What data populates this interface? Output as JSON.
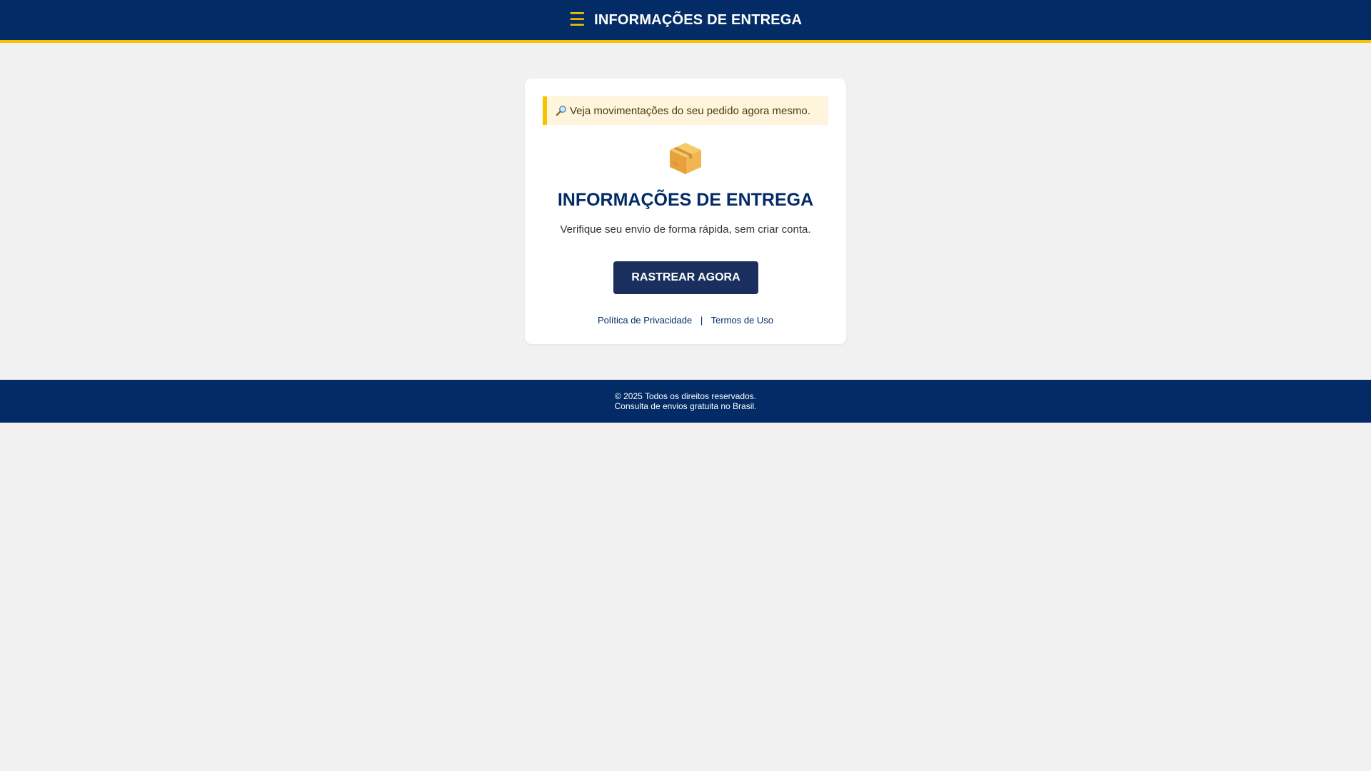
{
  "header": {
    "menu_icon": "hamburger-menu-icon",
    "menu_glyph": "☰",
    "title": "INFORMAÇÕES DE ENTREGA"
  },
  "notice": {
    "icon": "magnifier-icon",
    "text": "Veja movimentações do seu pedido agora mesmo."
  },
  "card": {
    "icon": "package-icon",
    "title": "INFORMAÇÕES DE ENTREGA",
    "subtitle": "Verifique seu envio de forma rápida, sem criar conta.",
    "button_label": "RASTREAR AGORA",
    "links": {
      "privacy": "Política de Privacidade",
      "separator": "|",
      "terms": "Termos de Uso"
    }
  },
  "footer": {
    "line1": "© 2025 Todos os direitos reservados.",
    "line2": "Consulta de envios gratuita no Brasil."
  },
  "colors": {
    "primary": "#032b66",
    "accent": "#f5c400",
    "button": "#1b2f5e",
    "notice_bg": "#fff4dc",
    "page_bg": "#f1f1f1"
  }
}
